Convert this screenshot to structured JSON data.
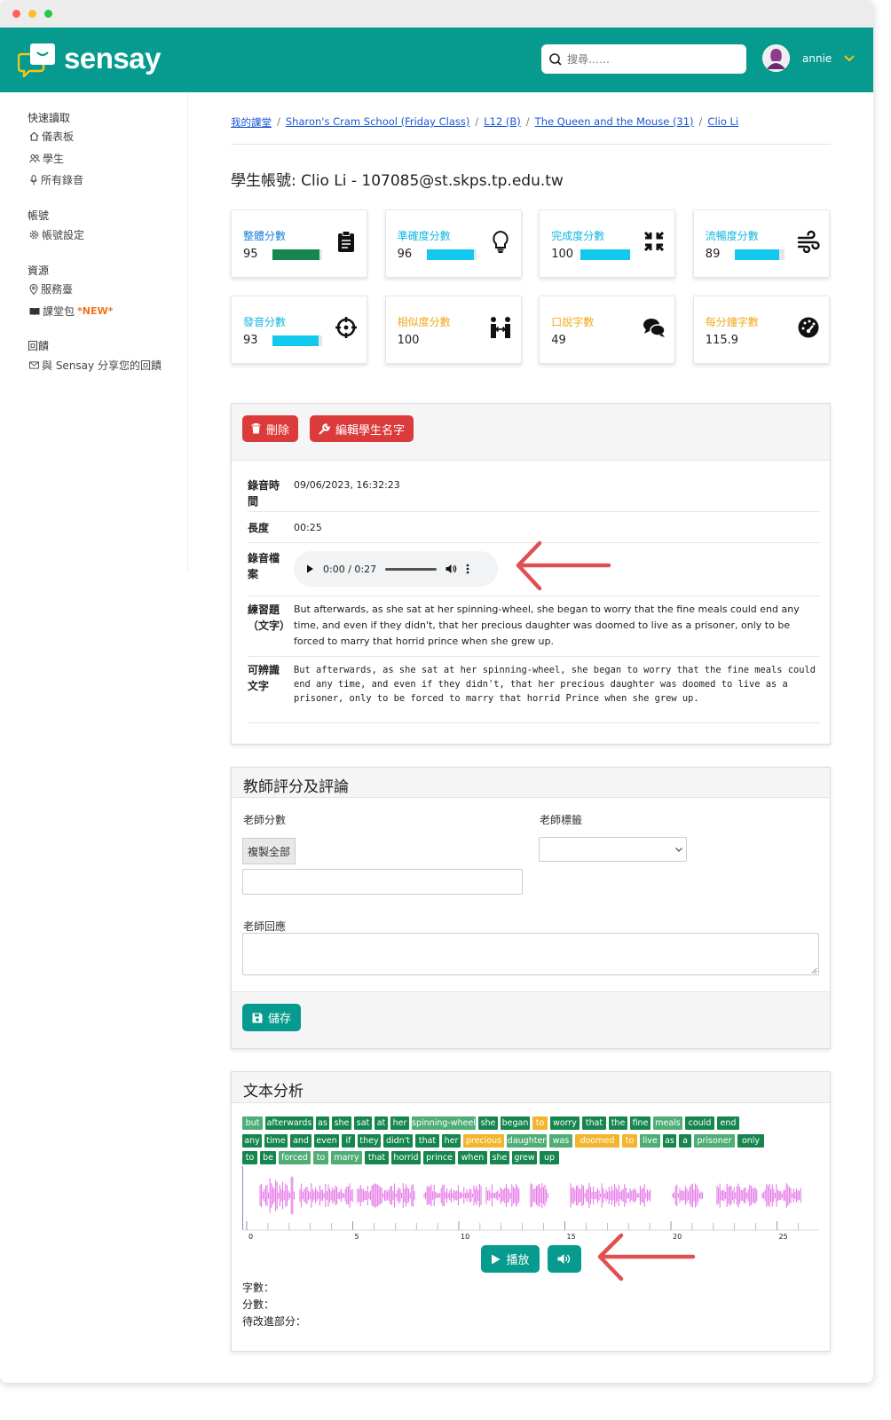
{
  "header": {
    "brand": "sensay",
    "search_placeholder": "搜尋……",
    "username": "annie"
  },
  "sidebar": {
    "groups": [
      {
        "heading": "快速讀取",
        "items": [
          {
            "label": "儀表板",
            "icon": "home-icon"
          },
          {
            "label": "學生",
            "icon": "users-icon"
          },
          {
            "label": "所有錄音",
            "icon": "microphone-icon"
          }
        ]
      },
      {
        "heading": "帳號",
        "items": [
          {
            "label": "帳號設定",
            "icon": "gear-icon"
          }
        ]
      },
      {
        "heading": "資源",
        "items": [
          {
            "label": "服務臺",
            "icon": "location-icon"
          },
          {
            "label": "課堂包",
            "icon": "book-icon",
            "badge": "*NEW*"
          }
        ]
      },
      {
        "heading": "回饋",
        "items": [
          {
            "label": "與 Sensay 分享您的回饋",
            "icon": "mail-icon"
          }
        ]
      }
    ]
  },
  "breadcrumb": [
    "我的課堂",
    "Sharon's Cram School (Friday Class)",
    "L12 (B)",
    "The Queen and the Mouse (31)",
    "Clio Li"
  ],
  "account": {
    "label": "學生帳號:",
    "value": " Clio Li - 107085@st.skps.tp.edu.tw"
  },
  "score_cards": [
    {
      "label": "整體分數",
      "value": "95",
      "bar_fraction": 0.95,
      "label_color": "#1a7fd4",
      "bar_color": "#16864f",
      "icon": "clipboard-icon"
    },
    {
      "label": "準確度分數",
      "value": "96",
      "bar_fraction": 0.96,
      "label_color": "#12b8e0",
      "bar_color": "#12c8ef",
      "icon": "lightbulb-icon"
    },
    {
      "label": "完成度分數",
      "value": "100",
      "bar_fraction": 1.0,
      "label_color": "#12b8e0",
      "bar_color": "#12c8ef",
      "icon": "compress-icon"
    },
    {
      "label": "流暢度分數",
      "value": "89",
      "bar_fraction": 0.89,
      "label_color": "#12b8e0",
      "bar_color": "#12c8ef",
      "icon": "wind-icon"
    },
    {
      "label": "發音分數",
      "value": "93",
      "bar_fraction": 0.93,
      "label_color": "#12b8e0",
      "bar_color": "#12c8ef",
      "icon": "crosshair-icon"
    },
    {
      "label": "相似度分數",
      "value": "100",
      "label_color": "#f2a81d",
      "icon": "people-arrows-icon"
    },
    {
      "label": "口說字數",
      "value": "49",
      "label_color": "#f2a81d",
      "icon": "comments-icon"
    },
    {
      "label": "每分鐘字數",
      "value": "115.9",
      "label_color": "#f2a81d",
      "icon": "gauge-icon"
    }
  ],
  "actions": {
    "delete": "刪除",
    "edit_name": "編輯學生名字"
  },
  "recording": {
    "time_label": "錄音時間",
    "time_value": "09/06/2023, 16:32:23",
    "length_label": "長度",
    "length_value": "00:25",
    "file_label": "錄音檔案",
    "player_time": "0:00 / 0:27",
    "exercise_label": "練習題（文字）",
    "exercise_text": "But afterwards, as she sat at her spinning-wheel, she began to worry that the fine meals could end any time, and even if they didn't, that her precious daughter was doomed to live as a prisoner, only to be forced to marry that horrid prince when she grew up.",
    "recognized_label": "可辨識文字",
    "recognized_text": "But afterwards, as she sat at her spinning-wheel, she began to worry that the fine meals could end any time, and even if they didn't, that her precious daughter was doomed to live as a prisoner, only to be forced to marry that horrid Prince when she grew up."
  },
  "teacher": {
    "title": "教師評分及評論",
    "score_label": "老師分數",
    "copy_all": "複製全部",
    "tag_label": "老師標籤",
    "response_label": "老師回應",
    "save": "儲存"
  },
  "analysis": {
    "title": "文本分析",
    "colors": {
      "good": "#16864f",
      "fair": "#4fae76",
      "warn": "#f2b52d"
    },
    "words": [
      [
        "but",
        "fair"
      ],
      [
        "afterwards",
        "good"
      ],
      [
        "as",
        "good"
      ],
      [
        "she",
        "good"
      ],
      [
        "sat",
        "good"
      ],
      [
        "at",
        "good"
      ],
      [
        "her",
        "good"
      ],
      [
        "spinning-wheel",
        "fair"
      ],
      [
        "she",
        "good"
      ],
      [
        "began",
        "good"
      ],
      [
        "to",
        "warn"
      ],
      [
        "worry",
        "good"
      ],
      [
        "that",
        "good"
      ],
      [
        "the",
        "good"
      ],
      [
        "fine",
        "good"
      ],
      [
        "meals",
        "fair"
      ],
      [
        "could",
        "good"
      ],
      [
        "end",
        "good"
      ],
      [
        "any",
        "good"
      ],
      [
        "time",
        "good"
      ],
      [
        "and",
        "good"
      ],
      [
        "even",
        "good"
      ],
      [
        "if",
        "good"
      ],
      [
        "they",
        "good"
      ],
      [
        "didn't",
        "good"
      ],
      [
        "that",
        "good"
      ],
      [
        "her",
        "good"
      ],
      [
        "precious",
        "warn"
      ],
      [
        "daughter",
        "fair"
      ],
      [
        "was",
        "fair"
      ],
      [
        "doomed",
        "warn"
      ],
      [
        "to",
        "warn"
      ],
      [
        "live",
        "fair"
      ],
      [
        "as",
        "good"
      ],
      [
        "a",
        "good"
      ],
      [
        "prisoner",
        "fair"
      ],
      [
        "only",
        "good"
      ],
      [
        "to",
        "good"
      ],
      [
        "be",
        "good"
      ],
      [
        "forced",
        "fair"
      ],
      [
        "to",
        "fair"
      ],
      [
        "marry",
        "fair"
      ],
      [
        "that",
        "good"
      ],
      [
        "horrid",
        "good"
      ],
      [
        "prince",
        "good"
      ],
      [
        "when",
        "good"
      ],
      [
        "she",
        "good"
      ],
      [
        "grew",
        "good"
      ],
      [
        "up",
        "good"
      ]
    ],
    "ticks": [
      "0",
      "5",
      "10",
      "15",
      "20",
      "25"
    ],
    "play": "播放",
    "word_count_label": "字數：",
    "score_label": "分數：",
    "improve_label": "待改進部分："
  }
}
